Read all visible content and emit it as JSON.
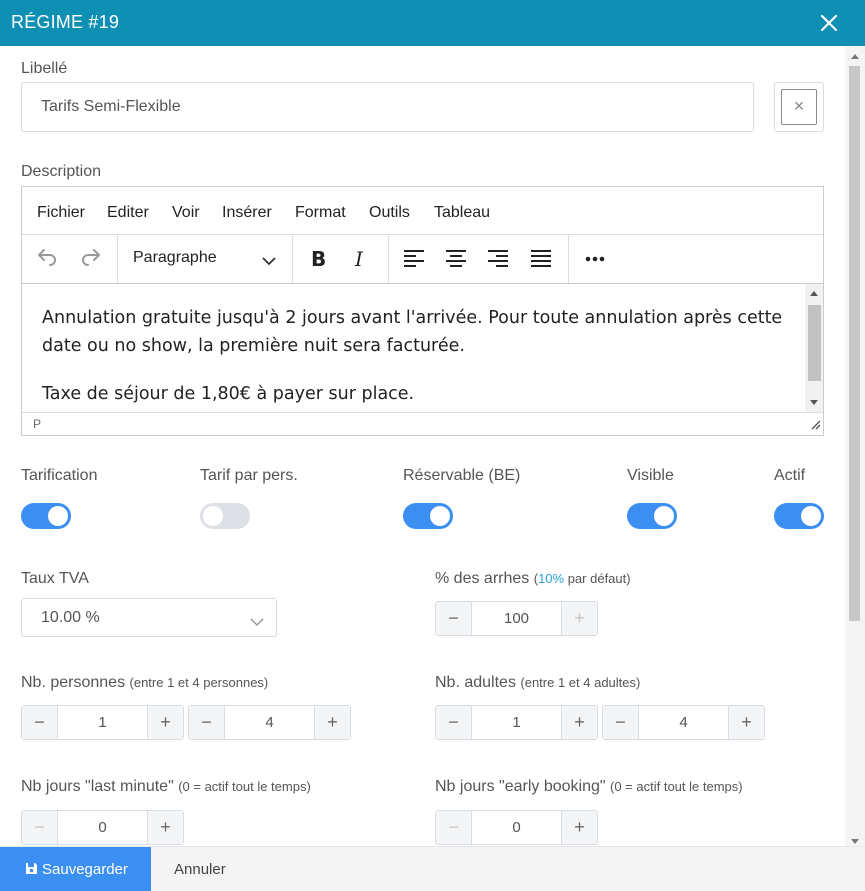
{
  "header": {
    "title": "RÉGIME #19"
  },
  "libelle": {
    "label": "Libellé",
    "value": "Tarifs Semi-Flexible",
    "clear_symbol": "×"
  },
  "description": {
    "label": "Description",
    "menu": [
      "Fichier",
      "Editer",
      "Voir",
      "Insérer",
      "Format",
      "Outils",
      "Tableau"
    ],
    "format_select": "Paragraphe",
    "content": [
      "Annulation gratuite jusqu'à 2 jours avant l'arrivée. Pour toute annulation après cette date ou no show, la première nuit sera facturée.",
      "Taxe de séjour de 1,80€ à payer sur place."
    ],
    "path": "P"
  },
  "toggles": {
    "tarification": {
      "label": "Tarification",
      "on": true
    },
    "tarif_par_pers": {
      "label": "Tarif par pers.",
      "on": false
    },
    "reservable": {
      "label": "Réservable (BE)",
      "on": true
    },
    "visible": {
      "label": "Visible",
      "on": true
    },
    "actif": {
      "label": "Actif",
      "on": true
    }
  },
  "taux_tva": {
    "label": "Taux TVA",
    "value": "10.00 %"
  },
  "arrhes": {
    "label": "% des arrhes",
    "paren_open": "(",
    "percent": "10%",
    "suffix": " par défaut)",
    "value": "100"
  },
  "nb_personnes": {
    "label": "Nb. personnes",
    "sub": "(entre 1 et 4 personnes)",
    "min": "1",
    "max": "4"
  },
  "nb_adultes": {
    "label": "Nb. adultes",
    "sub": "(entre 1 et 4 adultes)",
    "min": "1",
    "max": "4"
  },
  "last_minute": {
    "label": "Nb jours \"last minute\"",
    "sub": "(0 = actif tout le temps)",
    "value": "0"
  },
  "early_booking": {
    "label": "Nb jours \"early booking\"",
    "sub": "(0 = actif tout le temps)",
    "value": "0"
  },
  "stepper_symbols": {
    "minus": "−",
    "plus": "+"
  },
  "footer": {
    "save": "Sauvegarder",
    "cancel": "Annuler"
  },
  "colors": {
    "header": "#0f8fb4",
    "primary": "#3b8ff0",
    "accent": "#2aa3db"
  },
  "icons": [
    "close-icon",
    "undo-icon",
    "redo-icon",
    "chevron-down-icon",
    "bold-icon",
    "italic-icon",
    "align-left-icon",
    "align-center-icon",
    "align-right-icon",
    "align-justify-icon",
    "more-icon",
    "save-icon"
  ]
}
